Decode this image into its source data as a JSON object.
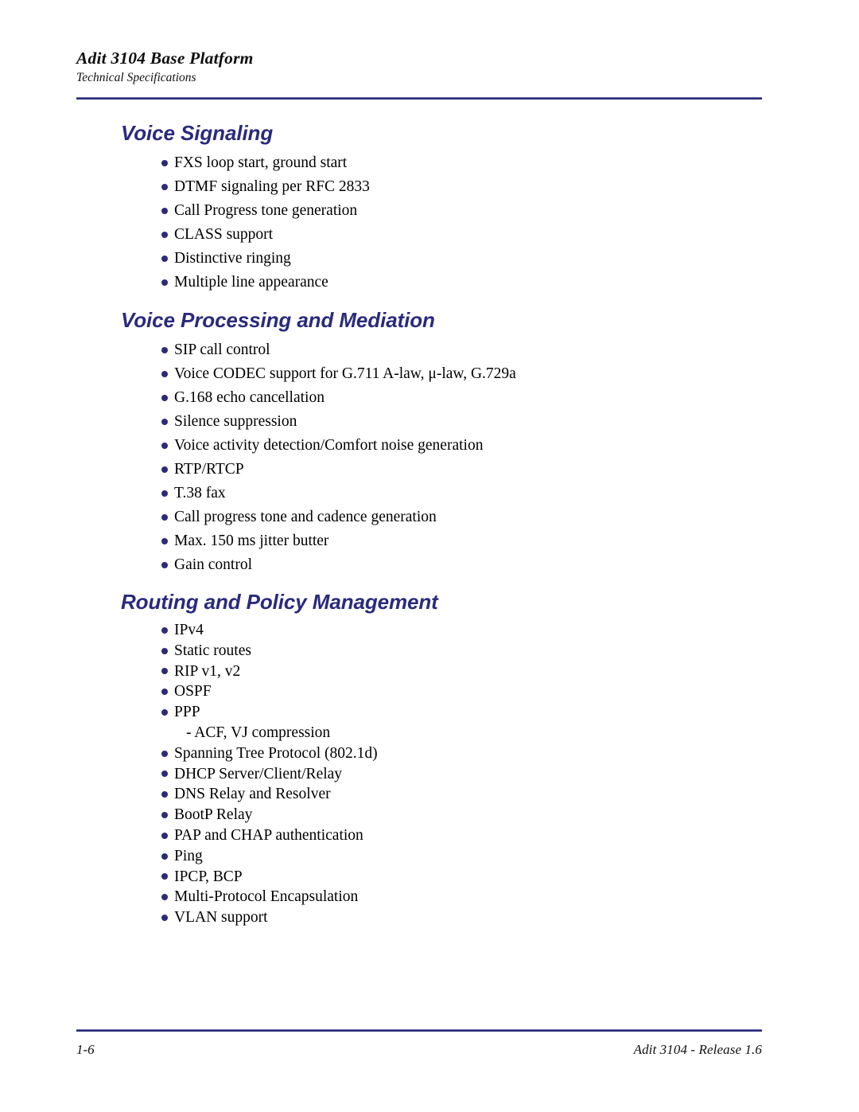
{
  "colors": {
    "heading": "#2a2a7c",
    "bullet": "#2b2b78",
    "rule": "#2b2b78",
    "body_text": "#000000",
    "background": "#ffffff"
  },
  "header": {
    "title": "Adit 3104 Base Platform",
    "subtitle": "Technical Specifications"
  },
  "sections": [
    {
      "heading": "Voice Signaling",
      "items": [
        {
          "text": "FXS loop start, ground start",
          "bulleted": true
        },
        {
          "text": "DTMF signaling per RFC 2833",
          "bulleted": true
        },
        {
          "text": "Call Progress tone generation",
          "bulleted": true
        },
        {
          "text": "CLASS support",
          "bulleted": true
        },
        {
          "text": "Distinctive ringing",
          "bulleted": true
        },
        {
          "text": "Multiple line appearance",
          "bulleted": true
        }
      ]
    },
    {
      "heading": "Voice Processing and Mediation",
      "items": [
        {
          "text": "SIP call control",
          "bulleted": true
        },
        {
          "text": "Voice CODEC support for G.711 A-law, μ-law, G.729a",
          "bulleted": true
        },
        {
          "text": "G.168 echo cancellation",
          "bulleted": true
        },
        {
          "text": "Silence suppression",
          "bulleted": true
        },
        {
          "text": "Voice activity detection/Comfort noise generation",
          "bulleted": true
        },
        {
          "text": "RTP/RTCP",
          "bulleted": true
        },
        {
          "text": "T.38 fax",
          "bulleted": true
        },
        {
          "text": "Call progress tone and cadence generation",
          "bulleted": true
        },
        {
          "text": "Max. 150 ms jitter butter",
          "bulleted": true
        },
        {
          "text": "Gain control",
          "bulleted": true
        }
      ]
    },
    {
      "heading": "Routing and Policy Management",
      "items": [
        {
          "text": "IPv4",
          "bulleted": true
        },
        {
          "text": "Static routes",
          "bulleted": true
        },
        {
          "text": "RIP v1, v2",
          "bulleted": true
        },
        {
          "text": "OSPF",
          "bulleted": true
        },
        {
          "text": "PPP",
          "bulleted": true
        },
        {
          "text": "- ACF, VJ compression",
          "bulleted": false
        },
        {
          "text": "Spanning Tree Protocol (802.1d)",
          "bulleted": true
        },
        {
          "text": "DHCP Server/Client/Relay",
          "bulleted": true
        },
        {
          "text": "DNS Relay and Resolver",
          "bulleted": true
        },
        {
          "text": "BootP Relay",
          "bulleted": true
        },
        {
          "text": "PAP and CHAP authentication",
          "bulleted": true
        },
        {
          "text": "Ping",
          "bulleted": true
        },
        {
          "text": "IPCP, BCP",
          "bulleted": true
        },
        {
          "text": "Multi-Protocol Encapsulation",
          "bulleted": true
        },
        {
          "text": "VLAN support",
          "bulleted": true
        }
      ]
    }
  ],
  "footer": {
    "page_number": "1-6",
    "release": "Adit 3104 - Release 1.6"
  }
}
